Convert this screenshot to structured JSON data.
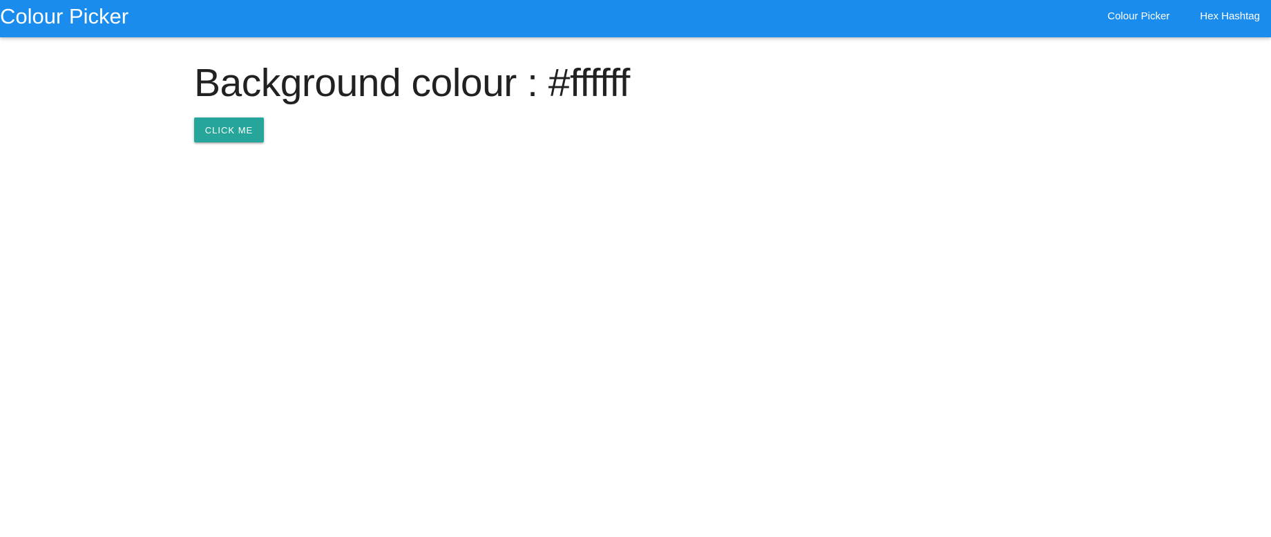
{
  "navbar": {
    "brand": "Colour Picker",
    "links": [
      {
        "label": "Colour Picker"
      },
      {
        "label": "Hex Hashtag"
      }
    ],
    "color": "#1a8cee"
  },
  "main": {
    "heading": "Background colour : #ffffff",
    "button_label": "CLICK ME",
    "button_color": "#26a69a",
    "background_color": "#ffffff"
  }
}
